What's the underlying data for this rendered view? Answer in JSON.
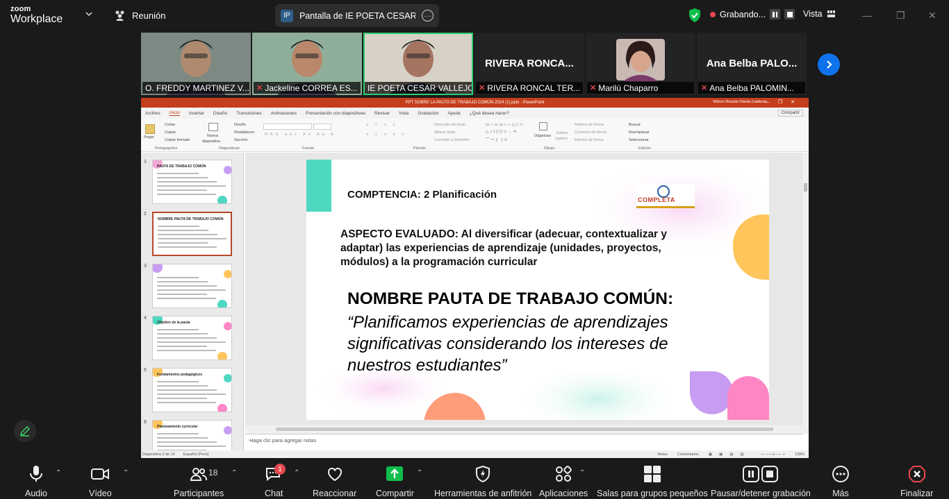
{
  "app": {
    "logo_top": "zoom",
    "logo_bottom": "Workplace"
  },
  "meeting": {
    "label": "Reunión"
  },
  "share": {
    "initials": "IP",
    "label": "Pantalla de IE POETA CESAR VALI"
  },
  "recording": {
    "label": "Grabando..."
  },
  "view": {
    "label": "Vista"
  },
  "participants": [
    {
      "name": "O. FREDDY MARTINEZ V...",
      "muted": false,
      "video": true,
      "skin": "#b08a70",
      "bg": "#7d8a83"
    },
    {
      "name": "Jackeline CORREA ES...",
      "muted": true,
      "video": true,
      "skin": "#b9886a",
      "bg": "#8fae9a"
    },
    {
      "name": "IE POETA CESAR VALLEJO",
      "muted": false,
      "video": true,
      "active": true,
      "skin": "#a47460",
      "bg": "#d8d2c6"
    },
    {
      "name": "RIVERA RONCAL TER...",
      "display": "RIVERA  RONCA...",
      "muted": true,
      "video": false
    },
    {
      "name": "Marilú Chaparro",
      "muted": true,
      "video": false,
      "avatar": true
    },
    {
      "name": "Ana Belba PALOMIN...",
      "display": "Ana Belba PALO...",
      "muted": true,
      "video": false
    }
  ],
  "ppt": {
    "title": "PPT SOBRE LA PAUTA DE TRABAJO COMÚN 2024 (1).pptx  -  PowerPoint",
    "user": "Wilson Ricardo Dávila Calderón",
    "tabs": [
      "Archivo",
      "Inicio",
      "Insertar",
      "Diseño",
      "Transiciones",
      "Animaciones",
      "Presentación con diapositivas",
      "Revisar",
      "Vista",
      "Grabación",
      "Ayuda",
      "¿Qué desea hacer?"
    ],
    "share_btn": "Compartir",
    "ribbon": {
      "groups": [
        "Portapapeles",
        "Diapositivas",
        "Fuente",
        "Párrafo",
        "Dibujo",
        "Edición"
      ],
      "items": {
        "pegar": "Pegar",
        "cortar": "Cortar",
        "copiar": "Copiar",
        "copiar_formato": "Copiar formato",
        "nueva": "Nueva",
        "diapositiva": "diapositiva",
        "diseno": "Diseño",
        "restablecer": "Restablecer",
        "seccion": "Sección",
        "direccion": "Dirección del texto",
        "alinear": "Alinear texto",
        "smartart": "Convertir a SmartArt",
        "organizar": "Organizar",
        "estilos": "Estilos",
        "rapidos": "rápidos",
        "relleno": "Relleno de forma",
        "contorno": "Contorno de forma",
        "efectos": "Efectos de forma",
        "buscar": "Buscar",
        "reemplazar": "Reemplazar",
        "seleccionar": "Seleccionar"
      }
    },
    "thumbnails": [
      "1",
      "2",
      "3",
      "4",
      "5",
      "6"
    ],
    "thumb_titles": [
      "PAUTA DE TRABAJO COMÚN",
      "NOMBRE PAUTA DE TRABAJO COMÚN:",
      "",
      "Objetivo de la pauta",
      "Fundamentos pedagógicos",
      "Planteamiento curricular"
    ],
    "slide": {
      "competencia": "COMPTENCIA: 2 Planificación",
      "aspecto": "ASPECTO EVALUADO: Al diversificar (adecuar, contextualizar y adaptar) las experiencias de aprendizaje (unidades, proyectos, módulos) a la programación curricular",
      "nombre": "NOMBRE PAUTA DE TRABAJO COMÚN:",
      "cita": "“Planificamos experiencias de aprendizajes significativas considerando los intereses de nuestros estudiantes”",
      "logo_text": "COMPLETA"
    },
    "notes_placeholder": "Haga clic para agregar notas",
    "status": {
      "slide": "Diapositiva 2 de 16",
      "lang": "Español (Perú)",
      "notas": "Notas",
      "comentarios": "Comentarios",
      "zoom": "139%"
    }
  },
  "toolbar": {
    "audio": "Audio",
    "video": "Vídeo",
    "participants": "Participantes",
    "participants_count": "18",
    "chat": "Chat",
    "chat_badge": "1",
    "react": "Reaccionar",
    "share": "Compartir",
    "host": "Herramientas de anfitrión",
    "apps": "Aplicaciones",
    "rooms": "Salas para grupos pequeños",
    "pause": "Pausar/detener grabación",
    "more": "Más",
    "end": "Finalizar"
  },
  "colors": {
    "accent": "#0e72ed",
    "share_green": "#0ebd4a",
    "end_red": "#e5484d",
    "ppt_orange": "#c43e1c"
  }
}
